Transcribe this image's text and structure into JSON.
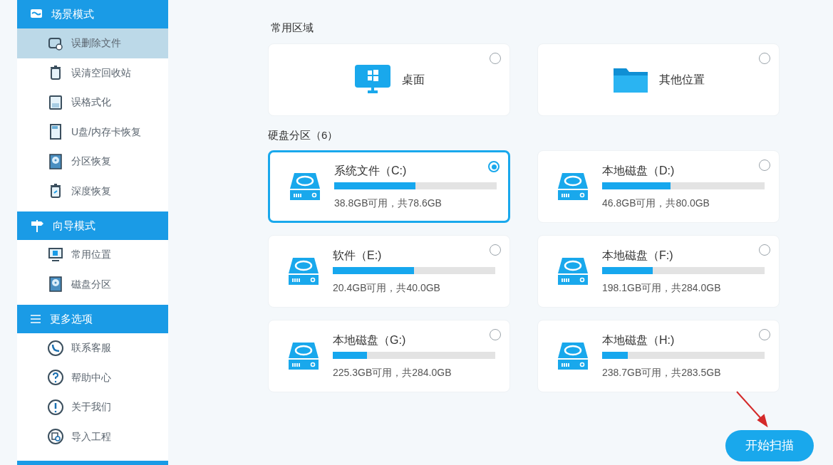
{
  "sidebar": {
    "sections": [
      {
        "title": "场景模式",
        "items": [
          {
            "label": "误删除文件",
            "selected": true
          },
          {
            "label": "误清空回收站",
            "selected": false
          },
          {
            "label": "误格式化",
            "selected": false
          },
          {
            "label": "U盘/内存卡恢复",
            "selected": false
          },
          {
            "label": "分区恢复",
            "selected": false
          },
          {
            "label": "深度恢复",
            "selected": false
          }
        ]
      },
      {
        "title": "向导模式",
        "items": [
          {
            "label": "常用位置",
            "selected": false
          },
          {
            "label": "磁盘分区",
            "selected": false
          }
        ]
      },
      {
        "title": "更多选项",
        "items": [
          {
            "label": "联系客服",
            "selected": false
          },
          {
            "label": "帮助中心",
            "selected": false
          },
          {
            "label": "关于我们",
            "selected": false
          },
          {
            "label": "导入工程",
            "selected": false
          }
        ]
      }
    ]
  },
  "common_area": {
    "title": "常用区域",
    "locations": [
      {
        "label": "桌面",
        "selected": false
      },
      {
        "label": "其他位置",
        "selected": false
      }
    ]
  },
  "partitions": {
    "title": "硬盘分区（6）",
    "drives": [
      {
        "name": "系统文件（C:)",
        "level": 0.5,
        "reading": "38.8GB可用，共78.6GB",
        "selected": true
      },
      {
        "name": "本地磁盘（D:)",
        "level": 0.42,
        "reading": "46.8GB可用，共80.0GB",
        "selected": false
      },
      {
        "name": "软件（E:)",
        "level": 0.5,
        "reading": "20.4GB可用，共40.0GB",
        "selected": false
      },
      {
        "name": "本地磁盘（F:)",
        "level": 0.31,
        "reading": "198.1GB可用，共284.0GB",
        "selected": false
      },
      {
        "name": "本地磁盘（G:)",
        "level": 0.21,
        "reading": "225.3GB可用，共284.0GB",
        "selected": false
      },
      {
        "name": "本地磁盘（H:)",
        "level": 0.16,
        "reading": "238.7GB可用，共283.5GB",
        "selected": false
      }
    ]
  },
  "scan_button": "开始扫描"
}
